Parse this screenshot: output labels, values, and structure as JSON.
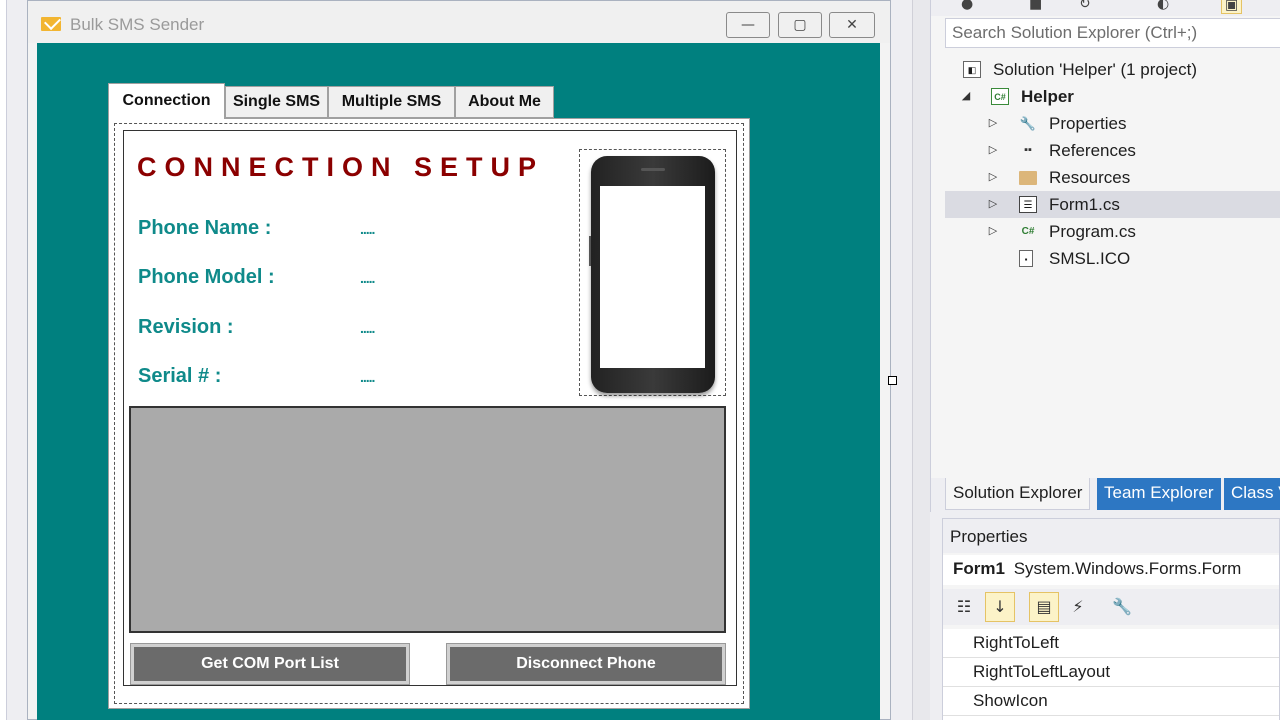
{
  "form": {
    "title": "Bulk SMS Sender",
    "caption_buttons": {
      "minimize": "—",
      "maximize": "▢",
      "close": "✕"
    },
    "tabs": [
      "Connection",
      "Single SMS",
      "Multiple SMS",
      "About Me"
    ],
    "active_tab": "Connection",
    "connection": {
      "heading": "CONNECTION SETUP",
      "fields": [
        {
          "label": "Phone Name :",
          "value": "....."
        },
        {
          "label": "Phone Model :",
          "value": "....."
        },
        {
          "label": "Revision :",
          "value": "....."
        },
        {
          "label": "Serial # :",
          "value": "....."
        }
      ],
      "buttons": {
        "com_ports": "Get COM Port List",
        "disconnect": "Disconnect Phone"
      }
    },
    "colors": {
      "client_background": "#00807f",
      "heading": "#8b0000",
      "label": "#0f8a8a",
      "log_area": "#aaaaaa"
    }
  },
  "solution_explorer": {
    "search_placeholder": "Search Solution Explorer (Ctrl+;)",
    "tree": [
      {
        "label": "Solution 'Helper' (1 project)",
        "icon": "solution-icon"
      },
      {
        "label": "Helper",
        "icon": "csharp-project-icon"
      },
      {
        "label": "Properties",
        "icon": "wrench-icon"
      },
      {
        "label": "References",
        "icon": "references-icon"
      },
      {
        "label": "Resources",
        "icon": "folder-icon"
      },
      {
        "label": "Form1.cs",
        "icon": "form-icon",
        "selected": true
      },
      {
        "label": "Program.cs",
        "icon": "csharp-file-icon"
      },
      {
        "label": "SMSL.ICO",
        "icon": "ico-file-icon"
      }
    ],
    "tabs": [
      "Solution Explorer",
      "Team Explorer",
      "Class V"
    ]
  },
  "properties": {
    "header": "Properties",
    "object_name": "Form1",
    "object_type": "System.Windows.Forms.Form",
    "rows": [
      "RightToLeft",
      "RightToLeftLayout",
      "ShowIcon"
    ]
  }
}
